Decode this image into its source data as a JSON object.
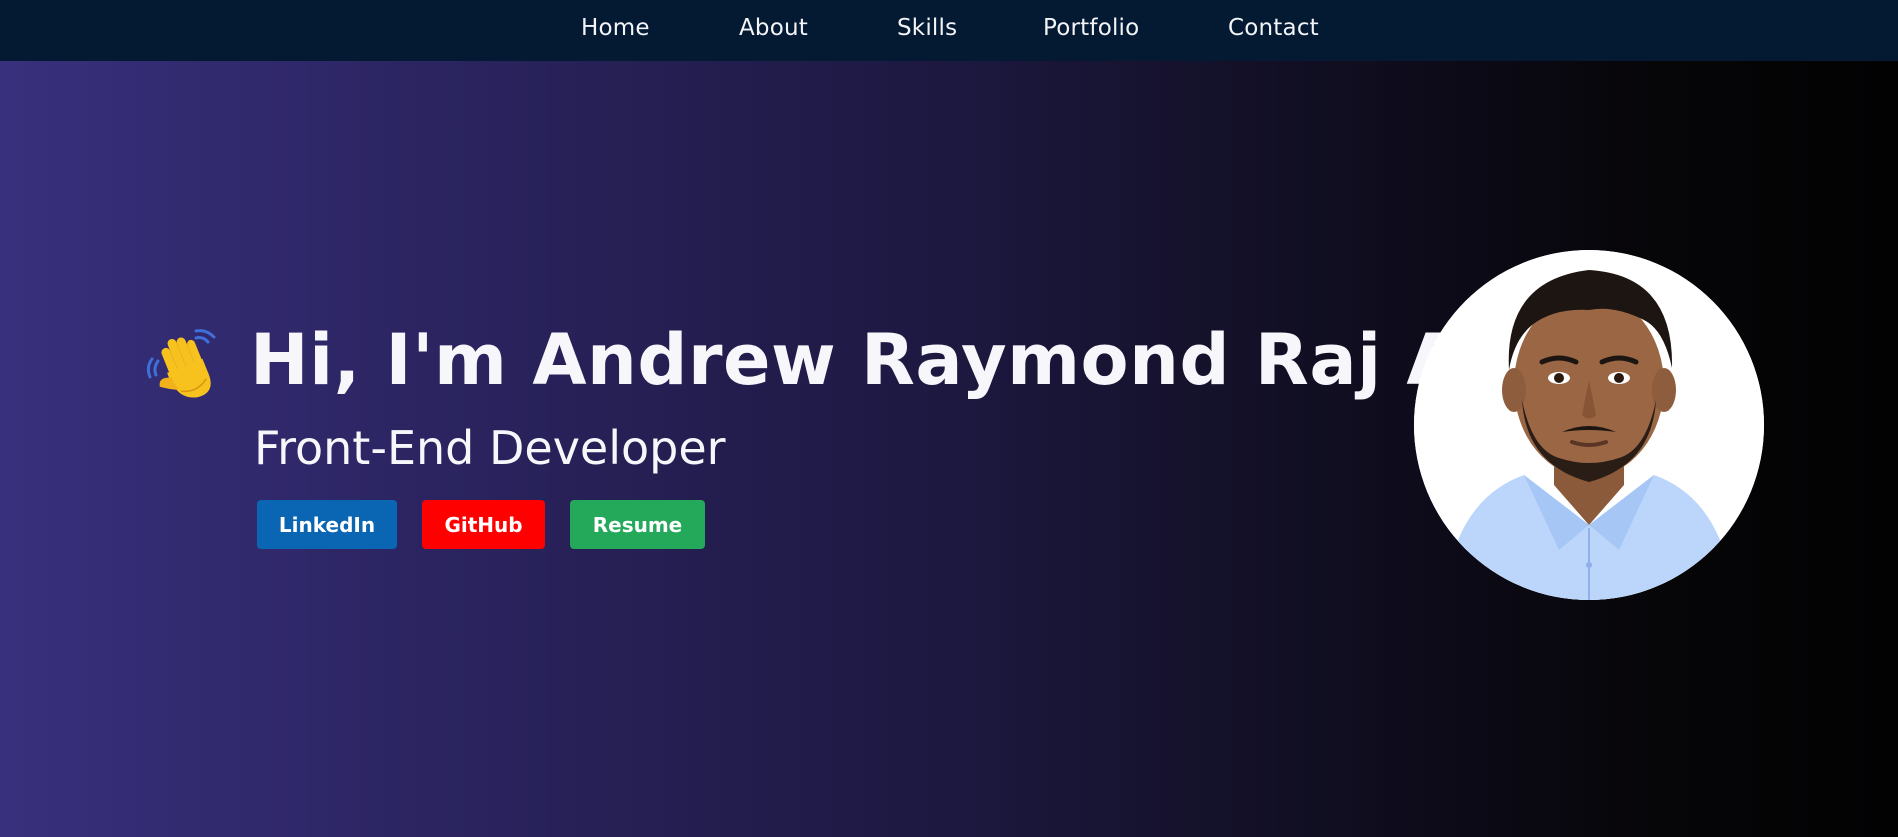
{
  "nav": {
    "items": [
      {
        "label": "Home"
      },
      {
        "label": "About"
      },
      {
        "label": "Skills"
      },
      {
        "label": "Portfolio"
      },
      {
        "label": "Contact"
      }
    ]
  },
  "hero": {
    "wave_icon": "waving-hand-icon",
    "headline": "Hi, I'm Andrew Raymond Raj A",
    "subtitle": "Front-End Developer",
    "buttons": {
      "linkedin": {
        "label": "LinkedIn",
        "color": "#0a66b3"
      },
      "github": {
        "label": "GitHub",
        "color": "#ff0000"
      },
      "resume": {
        "label": "Resume",
        "color": "#24a85a"
      }
    }
  },
  "colors": {
    "navbar_bg": "#041932",
    "gradient_start": "#38307c",
    "gradient_end": "#020203",
    "text": "#f6f6fb"
  }
}
